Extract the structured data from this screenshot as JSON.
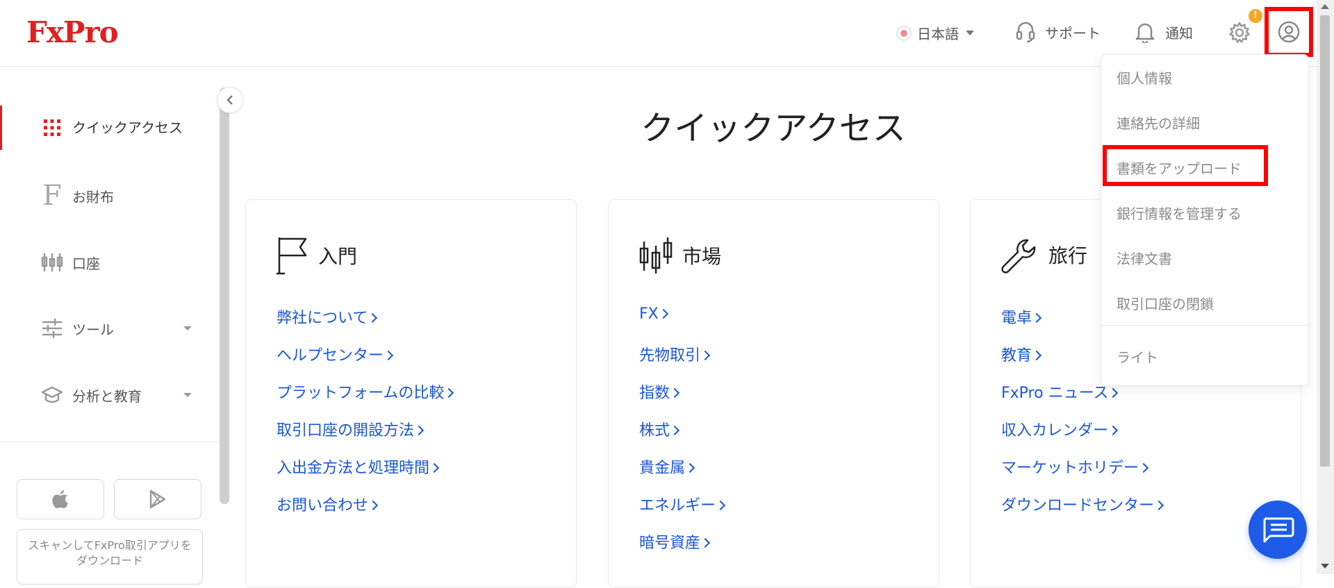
{
  "brand": {
    "logo": "FxPro",
    "accent": "#e02020",
    "link_color": "#1a56d6"
  },
  "header": {
    "language": "日本語",
    "support": "サポート",
    "notifications": "通知",
    "settings_badge": "!",
    "icons": [
      "language-flag-icon",
      "headset-icon",
      "bell-icon",
      "gear-icon",
      "user-circle-icon"
    ]
  },
  "sidebar": {
    "items": [
      {
        "label": "クイックアクセス",
        "icon": "grid-icon",
        "active": true
      },
      {
        "label": "お財布",
        "icon": "wallet-f-icon"
      },
      {
        "label": "口座",
        "icon": "candles-icon"
      },
      {
        "label": "ツール",
        "icon": "sliders-icon",
        "expandable": true
      },
      {
        "label": "分析と教育",
        "icon": "graduation-cap-icon",
        "expandable": true
      }
    ],
    "apps": {
      "ios_icon": "apple-icon",
      "android_icon": "play-store-icon"
    },
    "qr_text": "スキャンしてFxPro取引アプリをダウンロード"
  },
  "main": {
    "title": "クイックアクセス",
    "cards": [
      {
        "title": "入門",
        "icon": "flag-icon",
        "links": [
          "弊社について",
          "ヘルプセンター",
          "プラットフォームの比較",
          "取引口座の開設方法",
          "入出金方法と処理時間",
          "お問い合わせ"
        ]
      },
      {
        "title": "市場",
        "icon": "candlestick-icon",
        "links": [
          "FX",
          "先物取引",
          "指数",
          "株式",
          "貴金属",
          "エネルギー",
          "暗号資産"
        ]
      },
      {
        "title": "旅行",
        "icon": "wrench-icon",
        "links": [
          "電卓",
          "教育",
          "FxPro ニュース",
          "収入カレンダー",
          "マーケットホリデー",
          "ダウンロードセンター"
        ]
      }
    ]
  },
  "user_menu": {
    "items": [
      "個人情報",
      "連絡先の詳細",
      "書類をアップロード",
      "銀行情報を管理する",
      "法律文書",
      "取引口座の閉鎖"
    ],
    "theme": "ライト",
    "highlighted": "書類をアップロード"
  },
  "chat": {
    "icon": "chat-bubble-icon"
  }
}
